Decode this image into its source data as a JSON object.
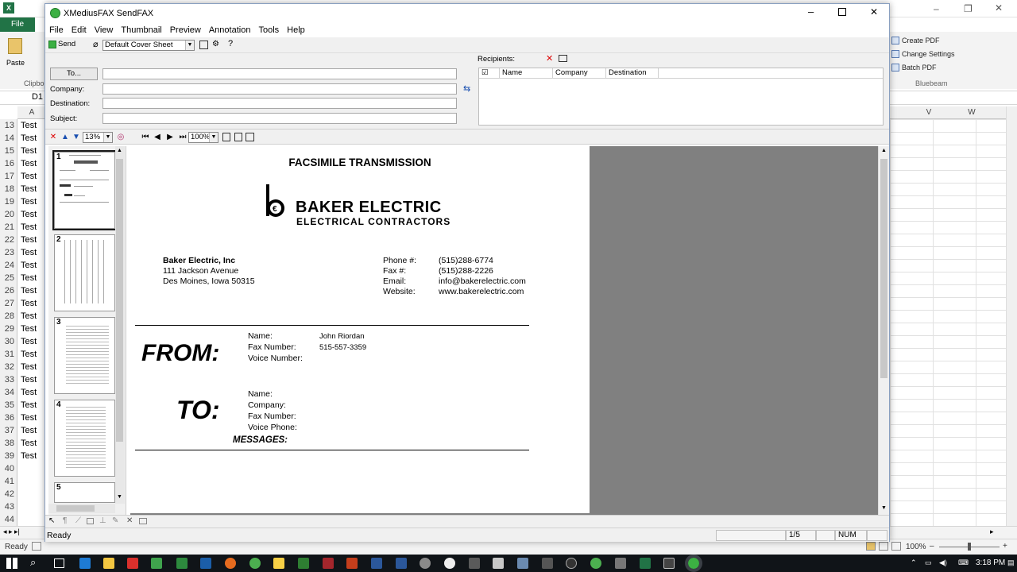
{
  "excel": {
    "file_tab": "File",
    "name_box": "D1",
    "col_headers": [
      "A",
      "V",
      "W"
    ],
    "rows": [
      {
        "num": "13",
        "val": "Test"
      },
      {
        "num": "14",
        "val": "Test"
      },
      {
        "num": "15",
        "val": "Test"
      },
      {
        "num": "16",
        "val": "Test"
      },
      {
        "num": "17",
        "val": "Test"
      },
      {
        "num": "18",
        "val": "Test"
      },
      {
        "num": "19",
        "val": "Test"
      },
      {
        "num": "20",
        "val": "Test"
      },
      {
        "num": "21",
        "val": "Test"
      },
      {
        "num": "22",
        "val": "Test"
      },
      {
        "num": "23",
        "val": "Test"
      },
      {
        "num": "24",
        "val": "Test"
      },
      {
        "num": "25",
        "val": "Test"
      },
      {
        "num": "26",
        "val": "Test"
      },
      {
        "num": "27",
        "val": "Test"
      },
      {
        "num": "28",
        "val": "Test"
      },
      {
        "num": "29",
        "val": "Test"
      },
      {
        "num": "30",
        "val": "Test"
      },
      {
        "num": "31",
        "val": "Test"
      },
      {
        "num": "32",
        "val": "Test"
      },
      {
        "num": "33",
        "val": "Test"
      },
      {
        "num": "34",
        "val": "Test"
      },
      {
        "num": "35",
        "val": "Test"
      },
      {
        "num": "36",
        "val": "Test"
      },
      {
        "num": "37",
        "val": "Test"
      },
      {
        "num": "38",
        "val": "Test"
      },
      {
        "num": "39",
        "val": "Test"
      },
      {
        "num": "40",
        "val": ""
      },
      {
        "num": "41",
        "val": ""
      },
      {
        "num": "42",
        "val": ""
      },
      {
        "num": "43",
        "val": ""
      },
      {
        "num": "44",
        "val": ""
      }
    ],
    "ribbon": {
      "paste_label": "Paste",
      "clipboard_label": "Clipbo",
      "create_pdf": "Create PDF",
      "change_settings": "Change Settings",
      "batch_pdf": "Batch PDF",
      "group_label": "Bluebeam"
    },
    "status": "Ready",
    "zoom": "100%"
  },
  "fax": {
    "title": "XMediusFAX SendFAX",
    "menu": [
      "File",
      "Edit",
      "View",
      "Thumbnail",
      "Preview",
      "Annotation",
      "Tools",
      "Help"
    ],
    "toolbar": {
      "send_label": "Send",
      "cover_sheet": "Default Cover Sheet"
    },
    "fields": {
      "to_button": "To...",
      "company_label": "Company:",
      "destination_label": "Destination:",
      "subject_label": "Subject:",
      "to_value": "",
      "company_value": "",
      "destination_value": "",
      "subject_value": ""
    },
    "recipients": {
      "label": "Recipients:",
      "columns": [
        "Name",
        "Company",
        "Destination"
      ]
    },
    "thumb_zoom": "13%",
    "page_zoom": "100%",
    "thumbnails": [
      "1",
      "2",
      "3",
      "4",
      "5"
    ],
    "status": {
      "text": "Ready",
      "page": "1/5",
      "num": "NUM"
    },
    "document": {
      "heading": "FACSIMILE TRANSMISSION",
      "company_name": "BAKER ELECTRIC",
      "company_tagline": "ELECTRICAL CONTRACTORS",
      "address": [
        "Baker Electric, Inc",
        "111 Jackson Avenue",
        "Des Moines, Iowa  50315"
      ],
      "contact_labels": [
        "Phone #:",
        "Fax #:",
        "Email:",
        "Website:"
      ],
      "contact_values": [
        "(515)288-6774",
        "(515)288-2226",
        "info@bakerelectric.com",
        "www.bakerelectric.com"
      ],
      "from_word": "FROM:",
      "from_labels": [
        "Name:",
        "Fax Number:",
        "Voice Number:"
      ],
      "from_values": [
        "John Riordan",
        "515-557-3359",
        ""
      ],
      "to_word": "TO:",
      "to_labels": [
        "Name:",
        "Company:",
        "Fax Number:",
        "Voice Phone:"
      ],
      "messages_label": "MESSAGES:"
    }
  },
  "taskbar": {
    "clock": "3:18 PM"
  }
}
